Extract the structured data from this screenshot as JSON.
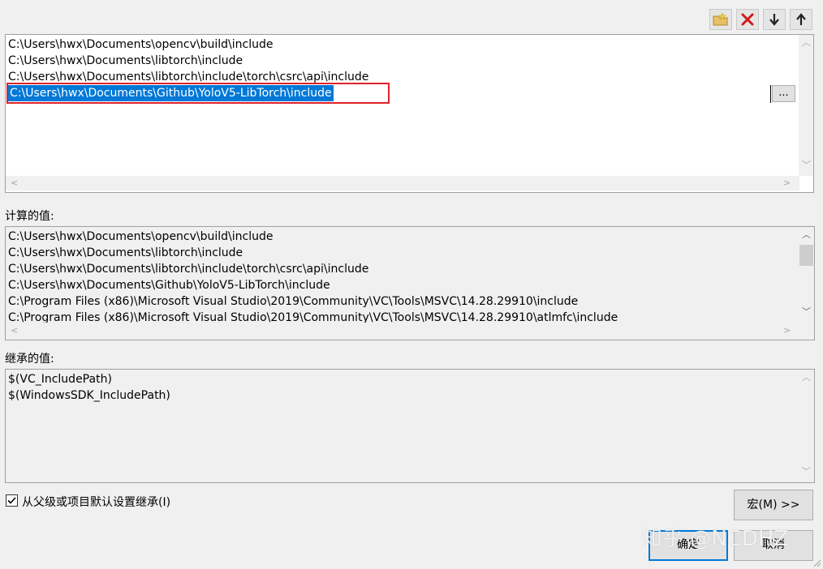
{
  "toolbar": {
    "new_line_icon": "new-line-icon",
    "delete_icon": "delete-icon",
    "move_down_icon": "move-down-icon",
    "move_up_icon": "move-up-icon"
  },
  "editor": {
    "lines": [
      "C:\\Users\\hwx\\Documents\\opencv\\build\\include",
      "C:\\Users\\hwx\\Documents\\libtorch\\include",
      "C:\\Users\\hwx\\Documents\\libtorch\\include\\torch\\csrc\\api\\include"
    ],
    "selected_line": "C:\\Users\\hwx\\Documents\\Github\\YoloV5-LibTorch\\include",
    "browse_label": "...",
    "highlight_color": "#0078d7",
    "annotation_color": "#e0212a"
  },
  "computed": {
    "label": "计算的值:",
    "lines": [
      "C:\\Users\\hwx\\Documents\\opencv\\build\\include",
      "C:\\Users\\hwx\\Documents\\libtorch\\include",
      "C:\\Users\\hwx\\Documents\\libtorch\\include\\torch\\csrc\\api\\include",
      "C:\\Users\\hwx\\Documents\\Github\\YoloV5-LibTorch\\include",
      "C:\\Program Files (x86)\\Microsoft Visual Studio\\2019\\Community\\VC\\Tools\\MSVC\\14.28.29910\\include",
      "C:\\Program Files (x86)\\Microsoft Visual Studio\\2019\\Community\\VC\\Tools\\MSVC\\14.28.29910\\atlmfc\\include"
    ]
  },
  "inherited": {
    "label": "继承的值:",
    "lines": [
      "$(VC_IncludePath)",
      "$(WindowsSDK_IncludePath)"
    ]
  },
  "inherit_checkbox": {
    "label": "从父级或项目默认设置继承(I)",
    "checked": true
  },
  "buttons": {
    "macros": "宏(M) >>",
    "ok": "确定",
    "cancel": "取消"
  },
  "watermark": "知乎 @NCDHZ"
}
